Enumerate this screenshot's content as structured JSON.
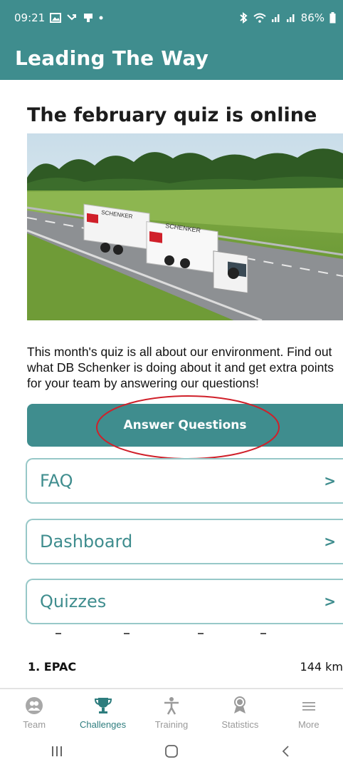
{
  "status_bar": {
    "time": "09:21",
    "battery": "86%"
  },
  "header": {
    "title": "Leading The Way"
  },
  "post": {
    "title": "The february quiz is online",
    "image_alt": "DB Schenker truck on highway",
    "truck_brand_text": "SCHENKER",
    "description": "This month's quiz is all about our environment. Find out what DB Schenker is doing about it and get extra points for your team by answering our questions!",
    "answer_button_label": "Answer Questions"
  },
  "menu": {
    "items": [
      {
        "label": "FAQ",
        "chevron": ">"
      },
      {
        "label": "Dashboard",
        "chevron": ">"
      },
      {
        "label": "Quizzes",
        "chevron": ">"
      }
    ]
  },
  "leaderboard": {
    "rows": [
      {
        "rank_name": "1. EPAC",
        "value": "144 km"
      }
    ]
  },
  "bottom_nav": {
    "items": [
      {
        "label": "Team",
        "icon": "team-icon"
      },
      {
        "label": "Challenges",
        "icon": "trophy-icon",
        "active": true
      },
      {
        "label": "Training",
        "icon": "person-icon"
      },
      {
        "label": "Statistics",
        "icon": "medal-icon"
      },
      {
        "label": "More",
        "icon": "menu-icon"
      }
    ]
  },
  "colors": {
    "primary": "#3f8d8e",
    "active_nav": "#2e7d7e",
    "inactive_nav": "#9a9a9a",
    "card_border": "#97c8c8",
    "highlight": "#d0202a"
  }
}
